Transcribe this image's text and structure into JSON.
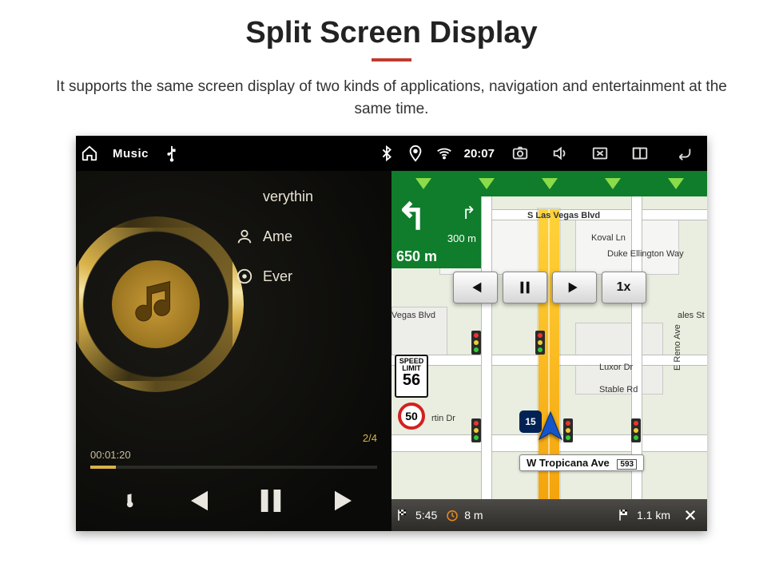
{
  "page": {
    "title": "Split Screen Display",
    "subtitle": "It supports the same screen display of two kinds of applications, navigation and entertainment at the same time."
  },
  "statusbar": {
    "app_title": "Music",
    "clock": "20:07"
  },
  "music": {
    "song_title_partial": "verythin",
    "artist_partial": "Ame",
    "album_partial": "Ever",
    "track_counter": "2/4",
    "elapsed": "00:01:20"
  },
  "map": {
    "turn": {
      "dist_small": "300 m",
      "dist_big": "650 m"
    },
    "playback_speed": "1x",
    "streets": {
      "top": "S Las Vegas Blvd",
      "koval": "Koval Ln",
      "duke": "Duke Ellington Way",
      "vegas_blvd2": "Vegas Blvd",
      "ales": "ales St",
      "luxor": "Luxor Dr",
      "stable": "Stable Rd",
      "reno": "E Reno Ave",
      "tropicana": "W Tropicana Ave",
      "tropicana_exit": "593",
      "martin": "rtin Dr"
    },
    "speed_limit_label": "SPEED LIMIT",
    "speed_limit": "56",
    "speed_current": "50",
    "interstate": "15",
    "bottom": {
      "eta": "5:45",
      "timeleft": "8 m",
      "dist": "1.1 km"
    }
  }
}
